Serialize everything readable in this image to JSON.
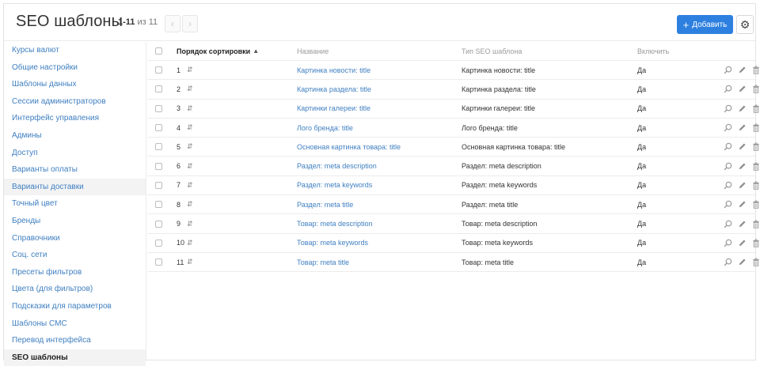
{
  "header": {
    "title": "SEO шаблоны",
    "range": "1-11",
    "of_label": "из",
    "total": "11",
    "prev_icon": "chevron-left-icon",
    "next_icon": "chevron-right-icon",
    "add_plus": "+",
    "add_label": "Добавить",
    "settings_icon": "gear-icon"
  },
  "colors": {
    "accent": "#2e80e0",
    "link": "#3f7fc1",
    "active_bg": "#f3f3f3"
  },
  "sidebar": {
    "items": [
      {
        "label": "Курсы валют"
      },
      {
        "label": "Общие настройки"
      },
      {
        "label": "Шаблоны данных"
      },
      {
        "label": "Сессии администраторов"
      },
      {
        "label": "Интерфейс управления"
      },
      {
        "label": "Админы"
      },
      {
        "label": "Доступ"
      },
      {
        "label": "Варианты оплаты"
      },
      {
        "label": "Варианты доставки"
      },
      {
        "label": "Точный цвет"
      },
      {
        "label": "Бренды"
      },
      {
        "label": "Справочники"
      },
      {
        "label": "Соц. сети"
      },
      {
        "label": "Пресеты фильтров"
      },
      {
        "label": "Цвета (для фильтров)"
      },
      {
        "label": "Подсказки для параметров"
      },
      {
        "label": "Шаблоны СМС"
      },
      {
        "label": "Перевод интерфейса"
      },
      {
        "label": "SEO шаблоны"
      }
    ],
    "active_index": 18,
    "hover_index": 8
  },
  "table": {
    "columns": {
      "order": "Порядок сортировки",
      "order_sort_icon": "▲",
      "name": "Название",
      "type": "Тип SEO шаблона",
      "enabled": "Включить"
    },
    "rows": [
      {
        "order": "1",
        "name": "Картинка новости: title",
        "type": "Картинка новости: title",
        "enabled": "Да"
      },
      {
        "order": "2",
        "name": "Картинка раздела: title",
        "type": "Картинка раздела: title",
        "enabled": "Да"
      },
      {
        "order": "3",
        "name": "Картинки галереи: title",
        "type": "Картинки галереи: title",
        "enabled": "Да"
      },
      {
        "order": "4",
        "name": "Лого бренда: title",
        "type": "Лого бренда: title",
        "enabled": "Да"
      },
      {
        "order": "5",
        "name": "Основная картинка товара: title",
        "type": "Основная картинка товара: title",
        "enabled": "Да"
      },
      {
        "order": "6",
        "name": "Раздел: meta description",
        "type": "Раздел: meta description",
        "enabled": "Да"
      },
      {
        "order": "7",
        "name": "Раздел: meta keywords",
        "type": "Раздел: meta keywords",
        "enabled": "Да"
      },
      {
        "order": "8",
        "name": "Раздел: meta title",
        "type": "Раздел: meta title",
        "enabled": "Да"
      },
      {
        "order": "9",
        "name": "Товар: meta description",
        "type": "Товар: meta description",
        "enabled": "Да"
      },
      {
        "order": "10",
        "name": "Товар: meta keywords",
        "type": "Товар: meta keywords",
        "enabled": "Да"
      },
      {
        "order": "11",
        "name": "Товар: meta title",
        "type": "Товар: meta title",
        "enabled": "Да"
      }
    ],
    "row_icons": [
      "view-icon",
      "edit-pencil-icon",
      "delete-trash-icon"
    ]
  }
}
